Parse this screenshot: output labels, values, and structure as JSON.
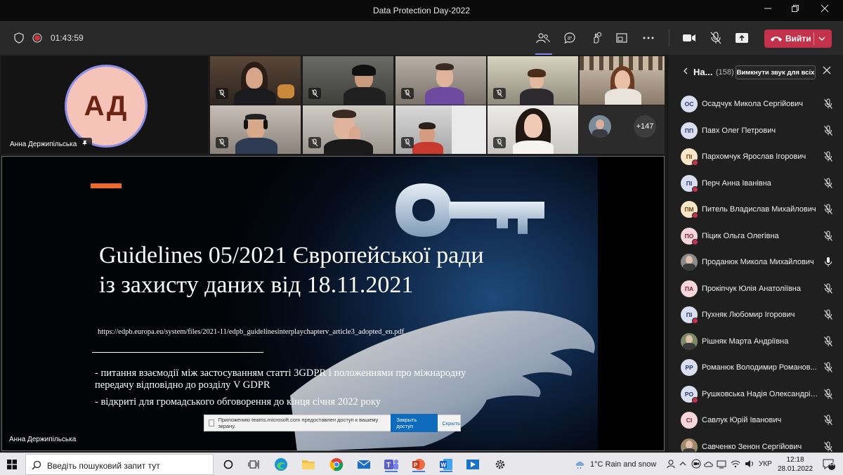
{
  "window": {
    "title": "Data Protection Day-2022"
  },
  "toolbar": {
    "timer": "01:43:59",
    "leave_label": "Вийти"
  },
  "stage": {
    "speaker": {
      "initials": "АД",
      "name": "Анна Держипільська"
    },
    "overflow_count": "+147",
    "slide": {
      "title_line1": "Guidelines 05/2021 Європейської ради",
      "title_line2": "із захисту даних від 18.11.2021",
      "link": "https://edpb.europa.eu/system/files/2021-11/edpb_guidelinesinterplaychapterv_article3_adopted_en.pdf",
      "bullet1_line1": "- питання взаємодії між застосуванням статті 3GDPR  і положеннями про міжнародну",
      "bullet1_line2": "передачу відповідно до розділу V GDPR",
      "bullet2": "- відкриті для громадського обговорення до кінця січня 2022 року",
      "presenter": "Анна Держипільська"
    },
    "notification": {
      "text": "Приложению teams.microsoft.com предоставлен доступ к вашему экрану.",
      "button": "Закрыть доступ",
      "hide": "Скрыть"
    }
  },
  "panel": {
    "title": "На...",
    "count": "(158)",
    "mute_all": "Вимкнути звук для всіх",
    "participants": [
      {
        "initials": "ОС",
        "name": "Осадчук Микола Сергійович",
        "color": "#d9dff0",
        "fg": "#2d3a6b",
        "mic": "off",
        "dot": false
      },
      {
        "initials": "ПП",
        "name": "Павх Олег Петрович",
        "color": "#d9dff0",
        "fg": "#2d3a6b",
        "mic": "off",
        "dot": false
      },
      {
        "initials": "ПІ",
        "name": "Пархомчук Ярослав Ігорович",
        "color": "#fbe6c8",
        "fg": "#6b4a1a",
        "mic": "off",
        "dot": true
      },
      {
        "initials": "ПІ",
        "name": "Перч Анна Іванівна",
        "color": "#d9dff0",
        "fg": "#2d3a6b",
        "mic": "off",
        "dot": true
      },
      {
        "initials": "ПМ",
        "name": "Питель Владислав Михайлович",
        "color": "#fbe6c8",
        "fg": "#6b4a1a",
        "mic": "off",
        "dot": true
      },
      {
        "initials": "ПО",
        "name": "Піцик Ольга Олегівна",
        "color": "#f6d5dc",
        "fg": "#7a2838",
        "mic": "off",
        "dot": true
      },
      {
        "initials": "",
        "name": "Проданюк Микола Михайлович",
        "color": "#8a8a8a",
        "fg": "#fff",
        "mic": "on",
        "dot": false
      },
      {
        "initials": "ПА",
        "name": "Прокіпчук Юлія Анатоліївна",
        "color": "#f6d5dc",
        "fg": "#7a2838",
        "mic": "off",
        "dot": false
      },
      {
        "initials": "ПІ",
        "name": "Пухняк Любомир Ігорович",
        "color": "#d9dff0",
        "fg": "#2d3a6b",
        "mic": "off",
        "dot": true
      },
      {
        "initials": "",
        "name": "Рішняк Марта Андріївна",
        "color": "#7d8a6a",
        "fg": "#fff",
        "mic": "off",
        "dot": false
      },
      {
        "initials": "РР",
        "name": "Романюк Володимир Романов...",
        "color": "#d9dff0",
        "fg": "#2d3a6b",
        "mic": "off",
        "dot": false
      },
      {
        "initials": "РО",
        "name": "Рушковська Надія Олександрів...",
        "color": "#d9dff0",
        "fg": "#2d3a6b",
        "mic": "off",
        "dot": true
      },
      {
        "initials": "СІ",
        "name": "Савлук Юрій Іванович",
        "color": "#f6d5dc",
        "fg": "#7a2838",
        "mic": "off",
        "dot": false
      },
      {
        "initials": "",
        "name": "Савченко Зенон Сергійович",
        "color": "#a08a6a",
        "fg": "#fff",
        "mic": "off",
        "dot": false
      }
    ]
  },
  "taskbar": {
    "search_placeholder": "Введіть пошуковий запит тут",
    "weather": "1°C  Rain and snow",
    "lang": "УКР",
    "time": "12:18",
    "date": "28.01.2022",
    "notif_count": "44"
  },
  "colors": {
    "leave": "#c4314b",
    "accent": "#7f85f5",
    "taskbar": "#e8e8ec"
  }
}
